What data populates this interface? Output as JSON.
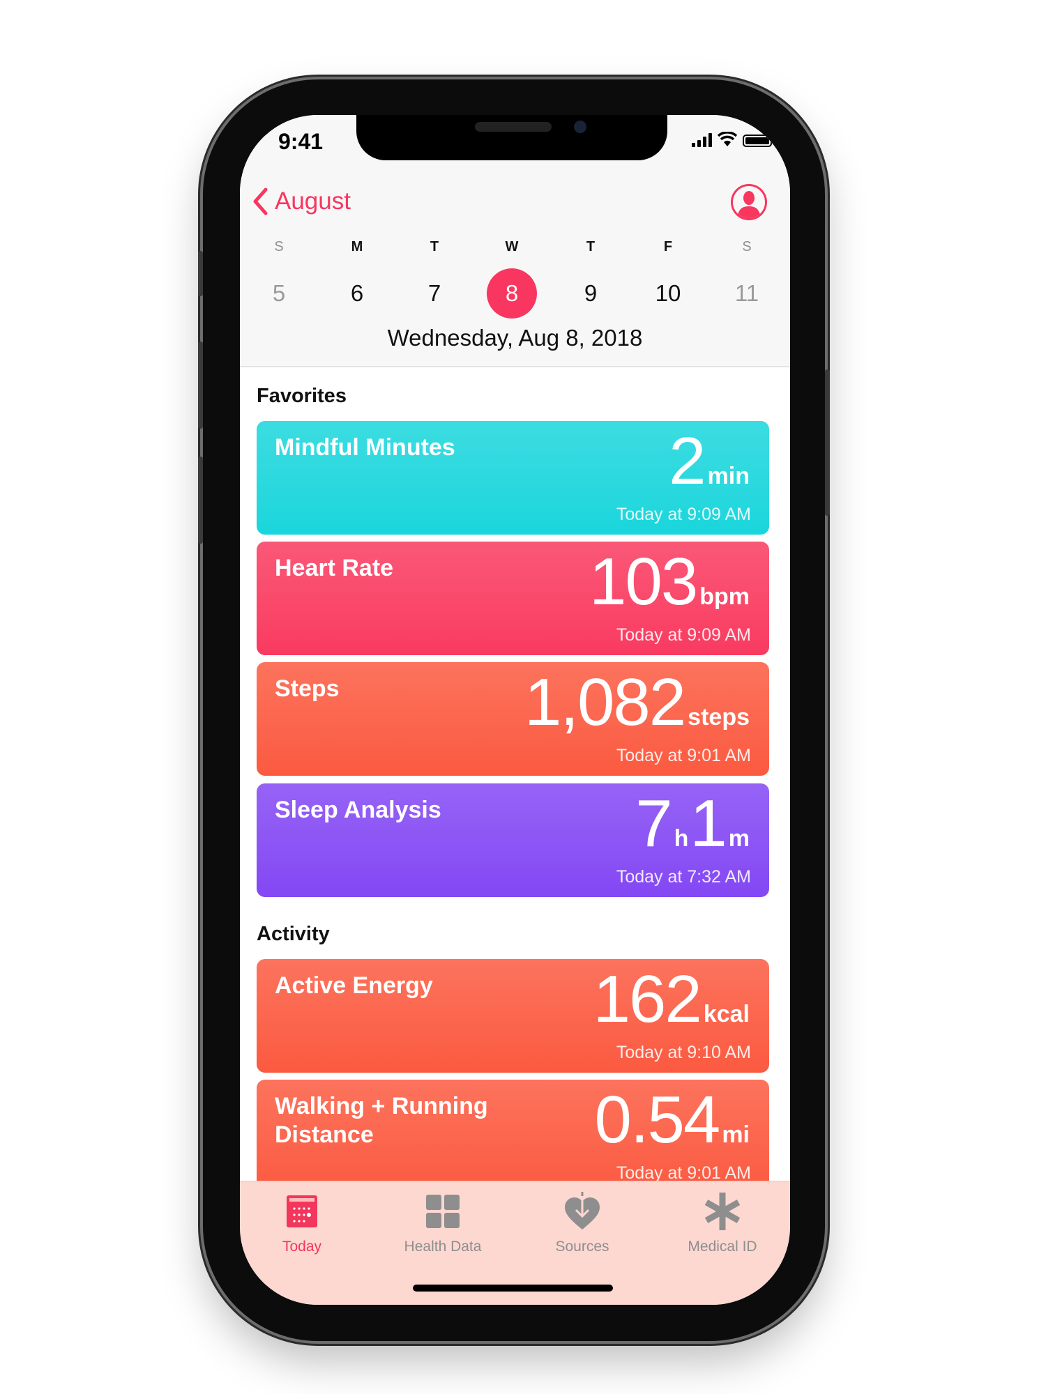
{
  "status_bar": {
    "time": "9:41"
  },
  "header": {
    "back_label": "August"
  },
  "calendar": {
    "weekdays": [
      "S",
      "M",
      "T",
      "W",
      "T",
      "F",
      "S"
    ],
    "days": [
      "5",
      "6",
      "7",
      "8",
      "9",
      "10",
      "11"
    ],
    "selected_day": "8",
    "selected_date": "Wednesday, Aug 8, 2018"
  },
  "favorites": {
    "label": "Favorites",
    "cards": [
      {
        "title": "Mindful Minutes",
        "value": "2",
        "unit": "min",
        "time": "Today at 9:09 AM",
        "color": "#18d6dc"
      },
      {
        "title": "Heart Rate",
        "value": "103",
        "unit": "bpm",
        "time": "Today at 9:09 AM",
        "color": "#f93a60"
      },
      {
        "title": "Steps",
        "value": "1,082",
        "unit": "steps",
        "time": "Today at 9:01 AM",
        "color": "#fb5a40"
      },
      {
        "title": "Sleep Analysis",
        "value": "7",
        "unit": "h",
        "value2": "1",
        "unit2": "m",
        "time": "Today at 7:32 AM",
        "color": "#8447f4"
      }
    ]
  },
  "activity": {
    "label": "Activity",
    "cards": [
      {
        "title": "Active Energy",
        "value": "162",
        "unit": "kcal",
        "time": "Today at 9:10 AM",
        "color": "#fb5a40"
      },
      {
        "title": "Walking + Running Distance",
        "value": "0.54",
        "unit": "mi",
        "time": "Today at 9:01 AM",
        "color": "#fb5a40"
      }
    ]
  },
  "tabs": [
    {
      "label": "Today",
      "icon": "calendar-icon",
      "active": true
    },
    {
      "label": "Health Data",
      "icon": "grid-icon",
      "active": false
    },
    {
      "label": "Sources",
      "icon": "heart-download-icon",
      "active": false
    },
    {
      "label": "Medical ID",
      "icon": "asterisk-icon",
      "active": false
    }
  ],
  "colors": {
    "accent": "#f8365e",
    "tab_bar_bg": "#fdd8d1",
    "inactive": "#8e8e8e"
  }
}
